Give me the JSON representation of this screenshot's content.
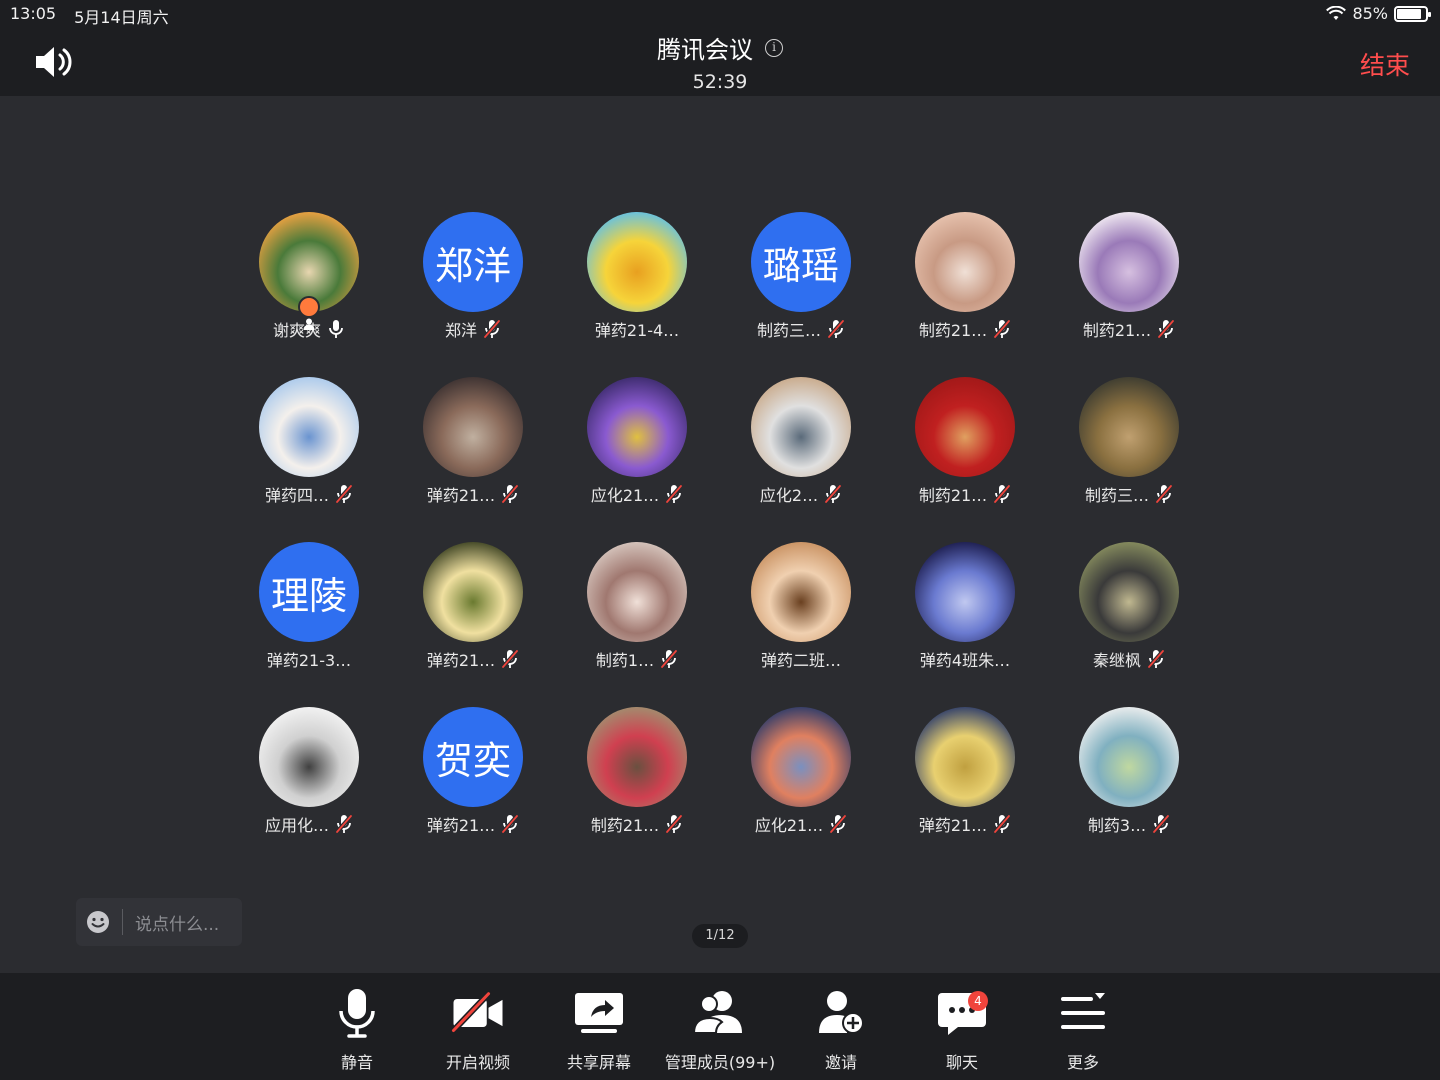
{
  "status_bar": {
    "time": "13:05",
    "date": "5月14日周六",
    "battery": "85%",
    "battery_level": 0.85
  },
  "header": {
    "title": "腾讯会议",
    "timer": "52:39",
    "end_label": "结束"
  },
  "participants": [
    {
      "name": "谢爽爽",
      "mic": "on",
      "host": true,
      "avatar_type": "image",
      "colors": [
        "#f4a442",
        "#4a7a3a",
        "#e8d6b0"
      ]
    },
    {
      "name": "郑洋",
      "mic": "muted",
      "avatar_type": "text",
      "avatar_text": "郑洋"
    },
    {
      "name": "弹药21-4…",
      "mic": "none",
      "avatar_type": "image",
      "colors": [
        "#5fc0e8",
        "#f6d43a",
        "#e8a020"
      ]
    },
    {
      "name": "制药三…",
      "mic": "muted",
      "avatar_type": "text",
      "avatar_text": "璐瑶"
    },
    {
      "name": "制药21…",
      "mic": "muted",
      "avatar_type": "image",
      "colors": [
        "#e8c4b0",
        "#c89a84",
        "#f0e0d6"
      ]
    },
    {
      "name": "制药21…",
      "mic": "muted",
      "avatar_type": "image",
      "colors": [
        "#f4eef4",
        "#9a7ab8",
        "#d6c0e0"
      ]
    },
    {
      "name": "弹药四…",
      "mic": "muted",
      "avatar_type": "image",
      "colors": [
        "#a8c8ec",
        "#f4f0ec",
        "#6a94d0"
      ]
    },
    {
      "name": "弹药21…",
      "mic": "muted",
      "avatar_type": "image",
      "colors": [
        "#3a3030",
        "#8a6a5a",
        "#c0b0a0"
      ]
    },
    {
      "name": "应化21…",
      "mic": "muted",
      "avatar_type": "image",
      "colors": [
        "#3a2a6a",
        "#8a5ad0",
        "#e0c040"
      ]
    },
    {
      "name": "应化2…",
      "mic": "muted",
      "avatar_type": "image",
      "colors": [
        "#c8a888",
        "#e0e0e0",
        "#5a6a7a"
      ]
    },
    {
      "name": "制药21…",
      "mic": "muted",
      "avatar_type": "image",
      "colors": [
        "#a01818",
        "#c02020",
        "#e0a060"
      ]
    },
    {
      "name": "制药三…",
      "mic": "muted",
      "avatar_type": "image",
      "colors": [
        "#3a3a30",
        "#8a7040",
        "#c0a070"
      ]
    },
    {
      "name": "弹药21-3…",
      "mic": "none",
      "avatar_type": "text",
      "avatar_text": "理陵"
    },
    {
      "name": "弹药21…",
      "mic": "muted",
      "avatar_type": "image",
      "colors": [
        "#3a4020",
        "#f0e0a0",
        "#6a7a30"
      ]
    },
    {
      "name": "制药1…",
      "mic": "muted",
      "avatar_type": "image",
      "colors": [
        "#d8c8c0",
        "#a07870",
        "#f0e0d8"
      ]
    },
    {
      "name": "弹药二班…",
      "mic": "none",
      "avatar_type": "image",
      "colors": [
        "#c89060",
        "#f0d0b0",
        "#6a4020"
      ]
    },
    {
      "name": "弹药4班朱…",
      "mic": "none",
      "avatar_type": "image",
      "colors": [
        "#1a1a4a",
        "#6a7ad0",
        "#c0c8f0"
      ]
    },
    {
      "name": "秦继枫",
      "mic": "muted",
      "avatar_type": "image",
      "colors": [
        "#8a9060",
        "#3a3a3a",
        "#c0b890"
      ]
    },
    {
      "name": "应用化…",
      "mic": "muted",
      "avatar_type": "image",
      "colors": [
        "#f4f4f4",
        "#d0d0d0",
        "#404040"
      ]
    },
    {
      "name": "弹药21…",
      "mic": "muted",
      "avatar_type": "text",
      "avatar_text": "贺奕"
    },
    {
      "name": "制药21…",
      "mic": "muted",
      "avatar_type": "image",
      "colors": [
        "#a09070",
        "#d04050",
        "#6a5040"
      ]
    },
    {
      "name": "应化21…",
      "mic": "muted",
      "avatar_type": "image",
      "colors": [
        "#2a3a6a",
        "#e08060",
        "#7a90c0"
      ]
    },
    {
      "name": "弹药21…",
      "mic": "muted",
      "avatar_type": "image",
      "colors": [
        "#2a3a6a",
        "#e8d070",
        "#c0a040"
      ]
    },
    {
      "name": "制药3…",
      "mic": "muted",
      "avatar_type": "image",
      "colors": [
        "#f0f0f0",
        "#80b0c0",
        "#c0d8a0"
      ]
    }
  ],
  "chat": {
    "placeholder": "说点什么..."
  },
  "pager": "1/12",
  "toolbar": {
    "mute": "静音",
    "video": "开启视频",
    "share": "共享屏幕",
    "members": "管理成员(99+)",
    "invite": "邀请",
    "chat": "聊天",
    "chat_badge": "4",
    "more": "更多"
  }
}
